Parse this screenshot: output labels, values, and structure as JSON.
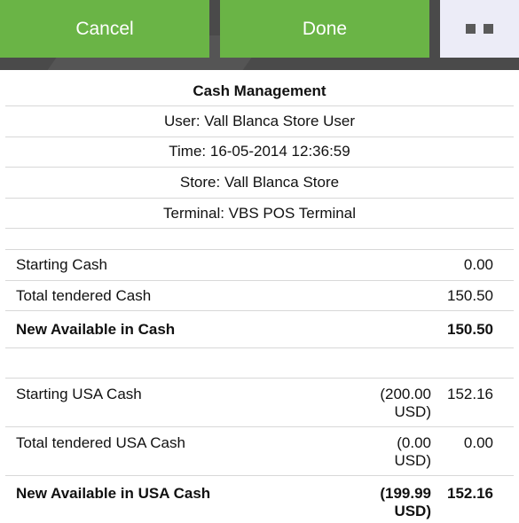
{
  "toolbar": {
    "cancel_label": "Cancel",
    "done_label": "Done",
    "menu_icon": "two-squares-menu-icon",
    "accent_color": "#6ab446"
  },
  "header": {
    "title": "Cash Management",
    "user": "User: Vall Blanca Store User",
    "time": "Time: 16-05-2014 12:36:59",
    "store": "Store: Vall Blanca Store",
    "terminal": "Terminal: VBS POS Terminal"
  },
  "cash": {
    "starting": {
      "label": "Starting Cash",
      "value": "0.00"
    },
    "tendered": {
      "label": "Total tendered Cash",
      "value": "150.50"
    },
    "available": {
      "label": "New Available in Cash",
      "value": "150.50"
    }
  },
  "usa_cash": {
    "starting": {
      "label": "Starting USA Cash",
      "original": "(200.00 USD)",
      "value": "152.16"
    },
    "tendered": {
      "label": "Total tendered USA Cash",
      "original": "(0.00 USD)",
      "value": "0.00"
    },
    "available": {
      "label": "New Available in USA Cash",
      "original": "(199.99 USD)",
      "value": "152.16"
    }
  }
}
